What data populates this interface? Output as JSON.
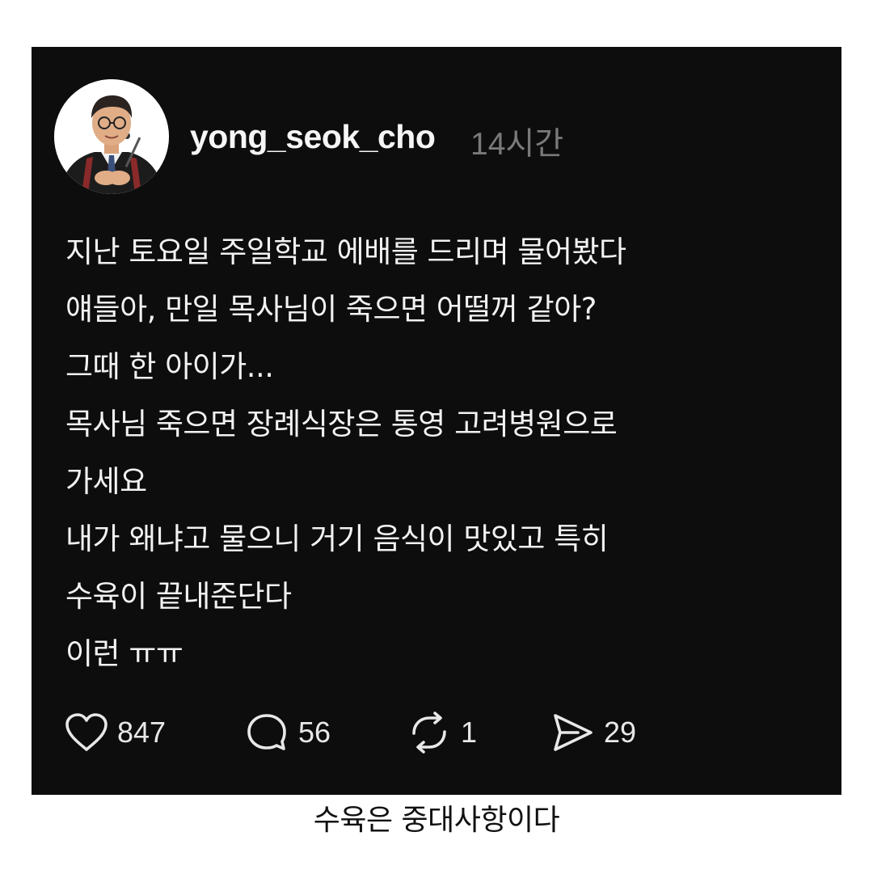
{
  "post": {
    "username": "yong_seok_cho",
    "timestamp": "14시간",
    "avatar_icon": "profile-avatar",
    "lines": [
      "지난 토요일 주일학교 에배를 드리며 물어봤다",
      "얘들아, 만일 목사님이 죽으면 어떨꺼 같아?",
      "그때 한 아이가...",
      "목사님 죽으면 장례식장은 통영 고려병원으로",
      "가세요",
      "내가 왜냐고 물으니 거기 음식이 맛있고 특히",
      "수육이 끝내준단다",
      "이런 ㅠㅠ"
    ],
    "actions": {
      "like": {
        "icon": "heart-icon",
        "count": "847"
      },
      "comment": {
        "icon": "comment-icon",
        "count": "56"
      },
      "repost": {
        "icon": "repost-icon",
        "count": "1"
      },
      "share": {
        "icon": "send-icon",
        "count": "29"
      }
    }
  },
  "caption": "수육은 중대사항이다",
  "colors": {
    "post_background": "#0d0d0d",
    "text": "#f2f2f2",
    "timestamp": "#7a7a7a",
    "page_background": "#ffffff"
  }
}
